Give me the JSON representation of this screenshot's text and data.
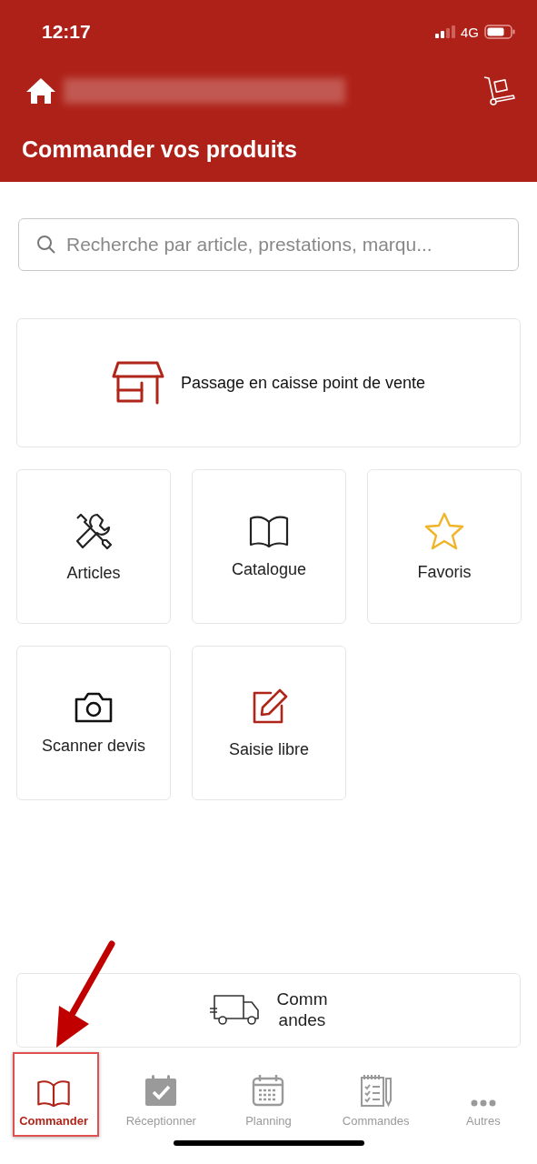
{
  "status_bar": {
    "time": "12:17",
    "network": "4G"
  },
  "header": {
    "title": "Commander vos produits"
  },
  "search": {
    "placeholder": "Recherche par article, prestations, marqu..."
  },
  "checkout_card": {
    "label": "Passage en caisse point de vente",
    "kind": "store"
  },
  "tiles": [
    {
      "label": "Articles",
      "kind": "tools"
    },
    {
      "label": "Catalogue",
      "kind": "book"
    },
    {
      "label": "Favoris",
      "kind": "star"
    },
    {
      "label": "Scanner devis",
      "kind": "camera"
    },
    {
      "label": "Saisie libre",
      "kind": "edit"
    }
  ],
  "orders_card": {
    "label": "Comm\nandes",
    "kind": "truck"
  },
  "tab_bar": [
    {
      "label": "Commander",
      "kind": "book",
      "selected": true
    },
    {
      "label": "Réceptionner",
      "kind": "check-calendar",
      "selected": false
    },
    {
      "label": "Planning",
      "kind": "calendar",
      "selected": false
    },
    {
      "label": "Commandes",
      "kind": "checklist",
      "selected": false
    },
    {
      "label": "Autres",
      "kind": "more",
      "selected": false
    }
  ],
  "annotation": {
    "shown": true
  }
}
